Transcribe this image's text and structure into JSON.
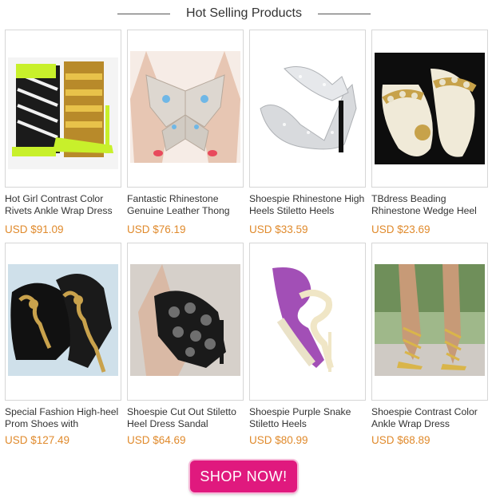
{
  "header": {
    "title": "Hot Selling Products"
  },
  "products": [
    {
      "name": "Hot Girl Contrast Color Rivets Ankle Wrap Dress",
      "price": "USD $91.09",
      "image_icon": "neon-strappy-heel-image"
    },
    {
      "name": "Fantastic Rhinestone Genuine Leather Thong",
      "price": "USD $76.19",
      "image_icon": "butterfly-rhinestone-sandal-image"
    },
    {
      "name": "Shoespie Rhinestone High Heels Stiletto Heels",
      "price": "USD $33.59",
      "image_icon": "silver-rhinestone-pump-image"
    },
    {
      "name": "TBdress Beading Rhinestone Wedge Heel",
      "price": "USD $23.69",
      "image_icon": "beaded-thong-sandal-image"
    },
    {
      "name": "Special Fashion High-heel Prom Shoes with",
      "price": "USD $127.49",
      "image_icon": "scorpion-heel-shoe-image"
    },
    {
      "name": "Shoespie Cut Out Stiletto Heel Dress Sandal",
      "price": "USD $64.69",
      "image_icon": "floral-cutout-bootie-image"
    },
    {
      "name": "Shoespie Purple Snake Stiletto Heels",
      "price": "USD $80.99",
      "image_icon": "purple-snake-heel-image"
    },
    {
      "name": "Shoespie Contrast Color Ankle Wrap Dress",
      "price": "USD $68.89",
      "image_icon": "gold-ankle-wrap-heel-image"
    }
  ],
  "cta": {
    "label": "SHOP NOW!"
  }
}
